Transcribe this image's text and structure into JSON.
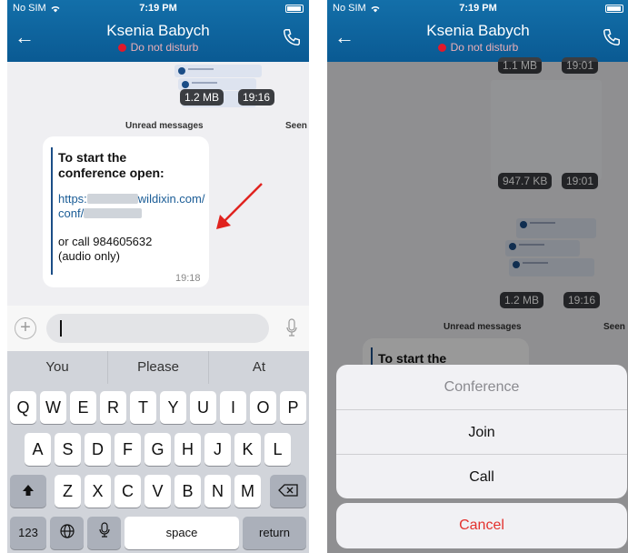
{
  "left": {
    "status": {
      "carrier": "No SIM",
      "time": "7:19 PM"
    },
    "header": {
      "contact": "Ksenia Babych",
      "status": "Do not disturb"
    },
    "chat": {
      "file_size": "1.2 MB",
      "file_time": "19:16",
      "unread_label": "Unread messages",
      "seen_label": "Seen",
      "message": {
        "line1": "To start the",
        "line2": "conference open:",
        "link_prefix": "https:",
        "link_domain": "wildixin.com/",
        "link_path": "conf/",
        "call_line": "or call 984605632",
        "audio_line": "(audio only)",
        "time": "19:18"
      }
    },
    "keyboard": {
      "suggestions": [
        "You",
        "Please",
        "At"
      ],
      "row1": [
        "Q",
        "W",
        "E",
        "R",
        "T",
        "Y",
        "U",
        "I",
        "O",
        "P"
      ],
      "row2": [
        "A",
        "S",
        "D",
        "F",
        "G",
        "H",
        "J",
        "K",
        "L"
      ],
      "row3": [
        "Z",
        "X",
        "C",
        "V",
        "B",
        "N",
        "M"
      ],
      "numbers": "123",
      "space": "space",
      "return": "return"
    }
  },
  "right": {
    "status": {
      "carrier": "No SIM",
      "time": "7:19 PM"
    },
    "header": {
      "contact": "Ksenia Babych",
      "status": "Do not disturb"
    },
    "chat": {
      "top_size": "1.1 MB",
      "top_time": "19:01",
      "mid_size": "947.7 KB",
      "mid_time": "19:01",
      "file_size": "1.2 MB",
      "file_time": "19:16",
      "unread_label": "Unread messages",
      "seen_label": "Seen",
      "message_peek": "To start the"
    },
    "sheet": {
      "title": "Conference",
      "join": "Join",
      "call": "Call",
      "cancel": "Cancel"
    }
  },
  "colors": {
    "header": "#0a5a93",
    "dnd": "#e0192b",
    "cancel": "#e3312d",
    "arrow": "#e0231f"
  }
}
